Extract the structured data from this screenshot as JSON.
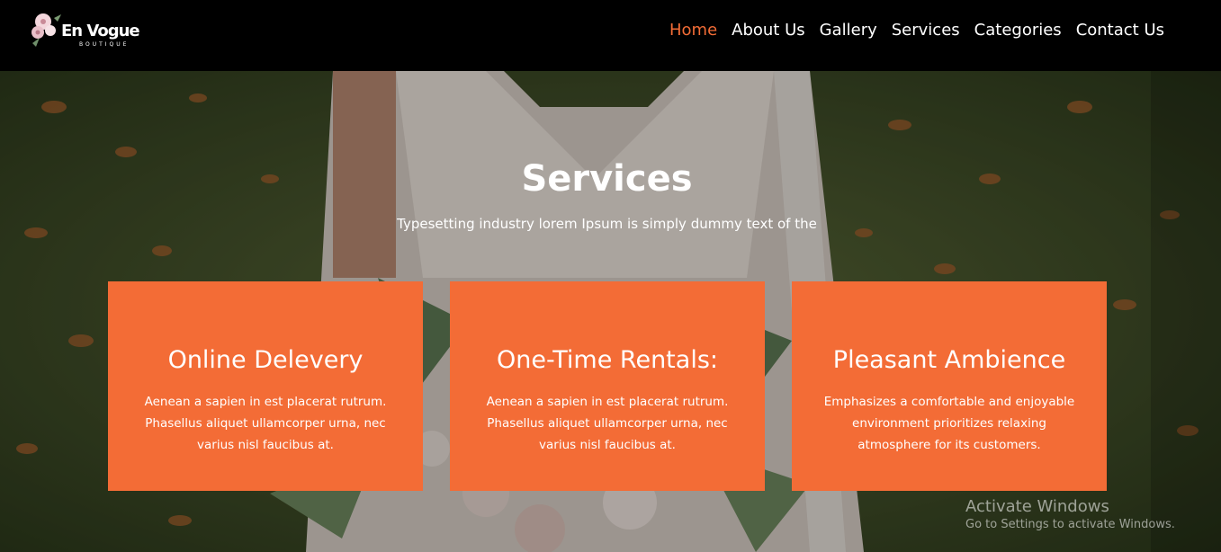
{
  "brand": {
    "name": "En Vogue",
    "tagline": "BOUTIQUE"
  },
  "nav": {
    "items": [
      {
        "label": "Home",
        "active": true
      },
      {
        "label": "About Us"
      },
      {
        "label": "Gallery"
      },
      {
        "label": "Services"
      },
      {
        "label": "Categories"
      },
      {
        "label": "Contact Us"
      }
    ]
  },
  "hero": {
    "title": "Services",
    "subtitle": "Typesetting industry lorem Ipsum is simply dummy text of the"
  },
  "cards": [
    {
      "title": "Online Delevery",
      "text": "Aenean a sapien in est placerat rutrum. Phasellus aliquet ullamcorper urna, nec varius nisl faucibus at."
    },
    {
      "title": "One-Time Rentals:",
      "text": "Aenean a sapien in est placerat rutrum. Phasellus aliquet ullamcorper urna, nec varius nisl faucibus at."
    },
    {
      "title": "Pleasant Ambience",
      "text": "Emphasizes a comfortable and enjoyable environment prioritizes relaxing atmosphere for its customers."
    }
  ],
  "watermark": {
    "title": "Activate Windows",
    "subtitle": "Go to Settings to activate Windows."
  },
  "colors": {
    "accent": "#f36c36",
    "header_bg": "#000000"
  }
}
